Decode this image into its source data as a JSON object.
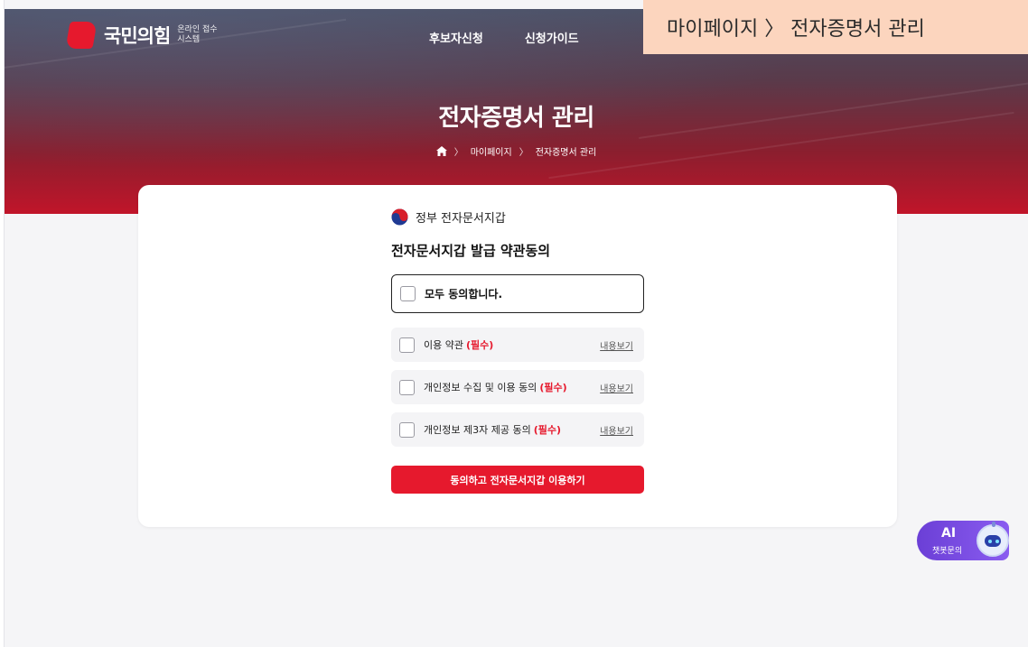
{
  "header": {
    "logo_name": "국민의힘",
    "logo_sub_line1": "온라인 접수",
    "logo_sub_line2": "시스템",
    "nav": [
      "후보자신청",
      "신청가이드"
    ]
  },
  "path_overlay": "마이페이지 〉 전자증명서 관리",
  "hero": {
    "title": "전자증명서 관리",
    "breadcrumb": [
      "마이페이지",
      "전자증명서 관리"
    ]
  },
  "card": {
    "gov_label": "정부 전자문서지갑",
    "title": "전자문서지갑 발급 약관동의",
    "all_agree": "모두 동의합니다.",
    "terms": [
      {
        "label": "이용 약관",
        "required": "(필수)",
        "view": "내용보기"
      },
      {
        "label": "개인정보 수집 및 이용 동의",
        "required": "(필수)",
        "view": "내용보기"
      },
      {
        "label": "개인정보 제3자 제공 동의",
        "required": "(필수)",
        "view": "내용보기"
      }
    ],
    "submit": "동의하고 전자문서지갑 이용하기"
  },
  "chatbot": {
    "title": "AI",
    "sub": "챗봇문의"
  },
  "colors": {
    "accent": "#e6192d",
    "overlay": "#fcd5be",
    "chatbot": "#7a4ee6"
  }
}
